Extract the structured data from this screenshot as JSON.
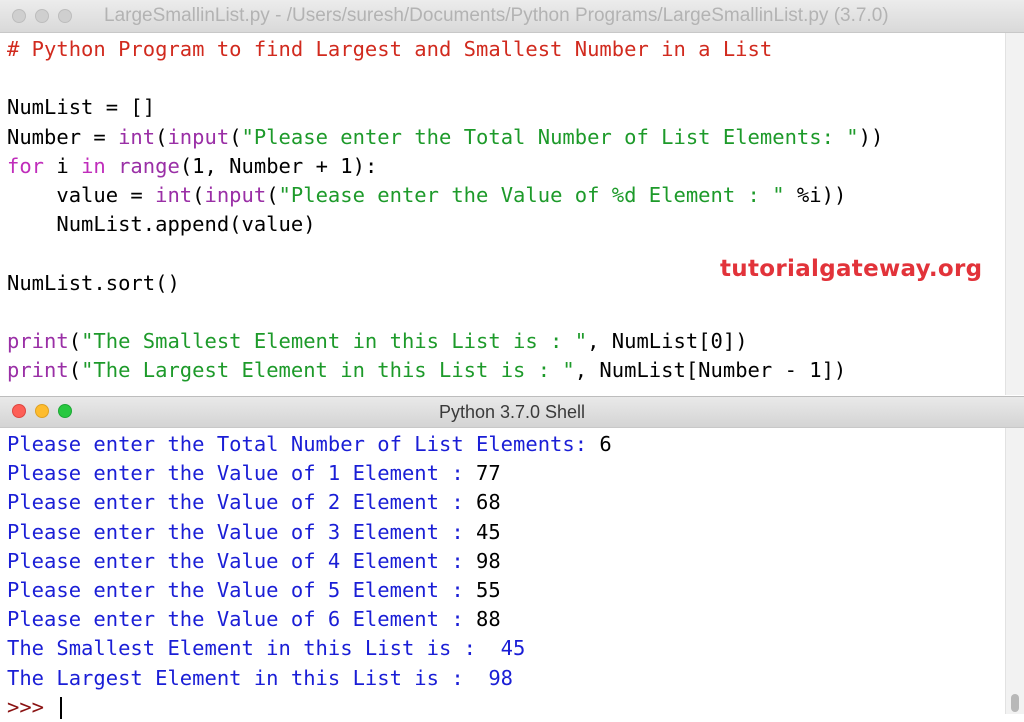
{
  "editor_window": {
    "title": "LargeSmallinList.py - /Users/suresh/Documents/Python Programs/LargeSmallinList.py (3.7.0)",
    "lines": [
      [
        {
          "t": "# Python Program to find Largest and Smallest Number in a List",
          "c": "comment"
        }
      ],
      [],
      [
        {
          "t": "NumList = []",
          "c": ""
        }
      ],
      [
        {
          "t": "Number = ",
          "c": ""
        },
        {
          "t": "int",
          "c": "bi"
        },
        {
          "t": "(",
          "c": ""
        },
        {
          "t": "input",
          "c": "bi"
        },
        {
          "t": "(",
          "c": ""
        },
        {
          "t": "\"Please enter the Total Number of List Elements: \"",
          "c": "str"
        },
        {
          "t": "))",
          "c": ""
        }
      ],
      [
        {
          "t": "for",
          "c": "kw"
        },
        {
          "t": " i ",
          "c": ""
        },
        {
          "t": "in",
          "c": "kw"
        },
        {
          "t": " ",
          "c": ""
        },
        {
          "t": "range",
          "c": "bi"
        },
        {
          "t": "(1, Number + 1):",
          "c": ""
        }
      ],
      [
        {
          "t": "    value = ",
          "c": ""
        },
        {
          "t": "int",
          "c": "bi"
        },
        {
          "t": "(",
          "c": ""
        },
        {
          "t": "input",
          "c": "bi"
        },
        {
          "t": "(",
          "c": ""
        },
        {
          "t": "\"Please enter the Value of %d Element : \"",
          "c": "str"
        },
        {
          "t": " %i))",
          "c": ""
        }
      ],
      [
        {
          "t": "    NumList.append(value)",
          "c": ""
        }
      ],
      [],
      [
        {
          "t": "NumList.sort()",
          "c": ""
        }
      ],
      [],
      [
        {
          "t": "print",
          "c": "bi"
        },
        {
          "t": "(",
          "c": ""
        },
        {
          "t": "\"The Smallest Element in this List is : \"",
          "c": "str"
        },
        {
          "t": ", NumList[0])",
          "c": ""
        }
      ],
      [
        {
          "t": "print",
          "c": "bi"
        },
        {
          "t": "(",
          "c": ""
        },
        {
          "t": "\"The Largest Element in this List is : \"",
          "c": "str"
        },
        {
          "t": ", NumList[Number - 1])",
          "c": ""
        }
      ]
    ]
  },
  "watermark": "tutorialgateway.org",
  "shell_window": {
    "title": "Python 3.7.0 Shell",
    "lines": [
      [
        {
          "t": "Please enter the Total Number of List Elements: ",
          "c": "out"
        },
        {
          "t": "6",
          "c": ""
        }
      ],
      [
        {
          "t": "Please enter the Value of 1 Element : ",
          "c": "out"
        },
        {
          "t": "77",
          "c": ""
        }
      ],
      [
        {
          "t": "Please enter the Value of 2 Element : ",
          "c": "out"
        },
        {
          "t": "68",
          "c": ""
        }
      ],
      [
        {
          "t": "Please enter the Value of 3 Element : ",
          "c": "out"
        },
        {
          "t": "45",
          "c": ""
        }
      ],
      [
        {
          "t": "Please enter the Value of 4 Element : ",
          "c": "out"
        },
        {
          "t": "98",
          "c": ""
        }
      ],
      [
        {
          "t": "Please enter the Value of 5 Element : ",
          "c": "out"
        },
        {
          "t": "55",
          "c": ""
        }
      ],
      [
        {
          "t": "Please enter the Value of 6 Element : ",
          "c": "out"
        },
        {
          "t": "88",
          "c": ""
        }
      ],
      [
        {
          "t": "The Smallest Element in this List is :  45",
          "c": "out"
        }
      ],
      [
        {
          "t": "The Largest Element in this List is :  98",
          "c": "out"
        }
      ]
    ],
    "prompt": ">>> "
  },
  "colors": {
    "comment": "#d12a1e",
    "keyword": "#c02dbb",
    "builtin": "#9a2fa6",
    "string": "#1d9a2a",
    "output": "#1a1ed6",
    "watermark": "#e2333a"
  },
  "icons": [
    "close-icon",
    "minimize-icon",
    "zoom-icon"
  ]
}
